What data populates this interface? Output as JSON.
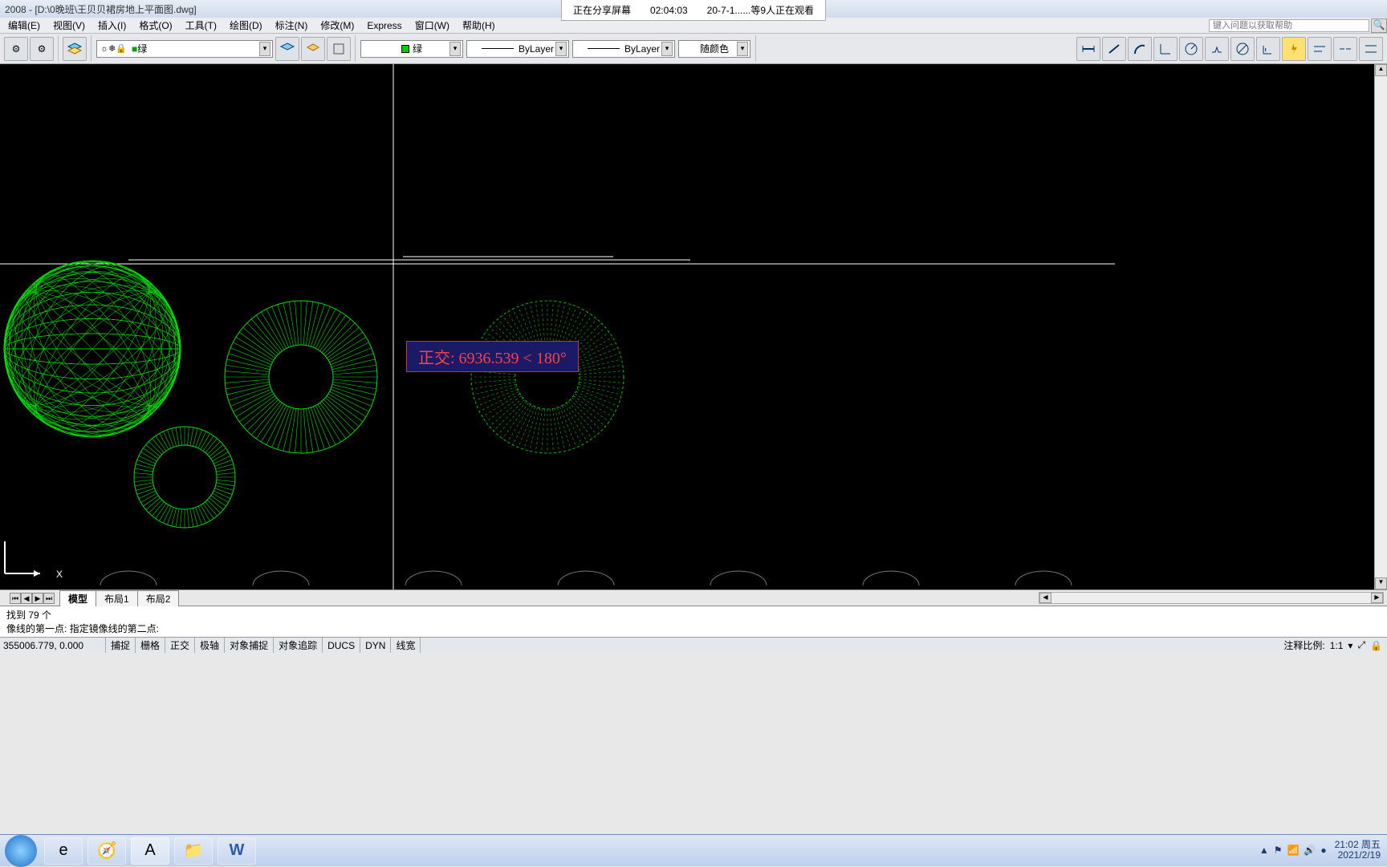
{
  "title": "2008 - [D:\\0晚班\\王贝贝裙房地上平面图.dwg]",
  "share": {
    "label": "正在分享屏幕",
    "time": "02:04:03",
    "viewers": "20-7-1......等9人正在观看"
  },
  "menus": [
    "编辑(E)",
    "视图(V)",
    "插入(I)",
    "格式(O)",
    "工具(T)",
    "绘图(D)",
    "标注(N)",
    "修改(M)",
    "Express",
    "窗口(W)",
    "帮助(H)"
  ],
  "help_placeholder": "键入问题以获取帮助",
  "layer": {
    "current": "绿",
    "icons": "☼❄🔒"
  },
  "props": {
    "color": "随颜色",
    "ltype": "ByLayer",
    "lweight": "ByLayer"
  },
  "tooltip": "正交: 6936.539 < 180°",
  "tabs": {
    "model": "模型",
    "layout1": "布局1",
    "layout2": "布局2"
  },
  "cmd": {
    "line1": "找到 79 个",
    "line2": "像线的第一点: 指定镜像线的第二点:"
  },
  "status": {
    "coords": "355006.779, 0.000",
    "toggles": [
      "捕捉",
      "栅格",
      "正交",
      "极轴",
      "对象捕捉",
      "对象追踪",
      "DUCS",
      "DYN",
      "线宽"
    ],
    "annoscale_label": "注释比例:",
    "annoscale": "1:1"
  },
  "clock": {
    "time": "21:02 周五",
    "date": "2021/2/19"
  }
}
